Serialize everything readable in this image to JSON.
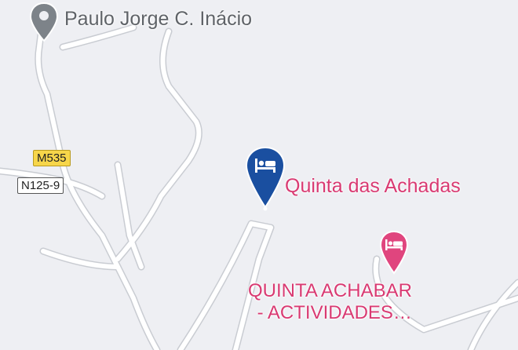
{
  "map": {
    "background_color": "#eeeff3",
    "road_color": "#ffffff",
    "road_casing_color": "#c9ccd2"
  },
  "places": {
    "poi_top": {
      "name": "Paulo Jorge C. Inácio",
      "icon": "location-pin-icon",
      "color": "#5f6368"
    },
    "hotel_main": {
      "name": "Quinta das Achadas",
      "icon": "hotel-bed-icon",
      "selected": true,
      "marker_color": "#1a4fa0",
      "label_color": "#d93a72"
    },
    "hotel_secondary": {
      "name_line1": "QUINTA ACHABAR",
      "name_line2": "- ACTIVIDADES…",
      "icon": "hotel-bed-icon",
      "label_color": "#d93a72"
    }
  },
  "road_shields": {
    "m535": {
      "label": "M535",
      "color": "#f7d64a"
    },
    "n125_9": {
      "label": "N125-9",
      "color": "#ffffff"
    }
  }
}
